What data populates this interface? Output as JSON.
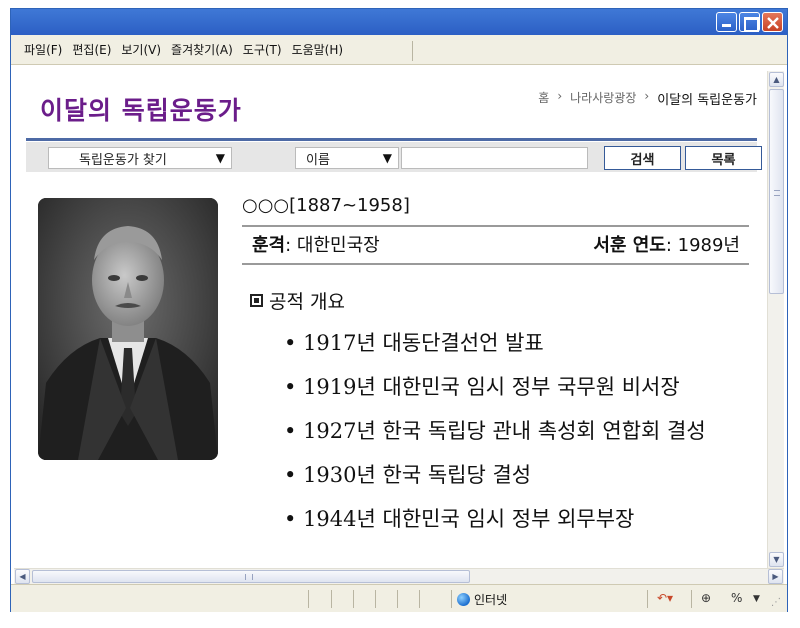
{
  "menu": [
    "파일(F)",
    "편집(E)",
    "보기(V)",
    "즐겨찾기(A)",
    "도구(T)",
    "도움말(H)"
  ],
  "page": {
    "title": "이달의 독립운동가",
    "breadcrumb": [
      "홈",
      "나라사랑광장",
      "이달의 독립운동가"
    ],
    "breadcrumb_sep": "›"
  },
  "search": {
    "category": "독립운동가 찾기",
    "field": "이름",
    "query": "",
    "search_label": "검색",
    "list_label": "목록",
    "caret": "▼"
  },
  "person": {
    "name_line": "○○○[1887~1958]",
    "order_label": "훈격",
    "order_value": "대한민국장",
    "year_label": "서훈 연도",
    "year_value": "1989년",
    "summary_title": "공적 개요",
    "achievements": [
      "1917년 대동단결선언 발표",
      "1919년 대한민국 임시 정부 국무원 비서장",
      "1927년 한국 독립당 관내 촉성회 연합회 결성",
      "1930년 한국 독립당 결성",
      "1944년 대한민국 임시 정부 외무부장"
    ]
  },
  "status": {
    "zone": "인터넷",
    "zoom": "%"
  },
  "colors": {
    "title": "#6b1d8a",
    "rule": "#4d6aa5",
    "titlebar": "#2c5fc4"
  }
}
